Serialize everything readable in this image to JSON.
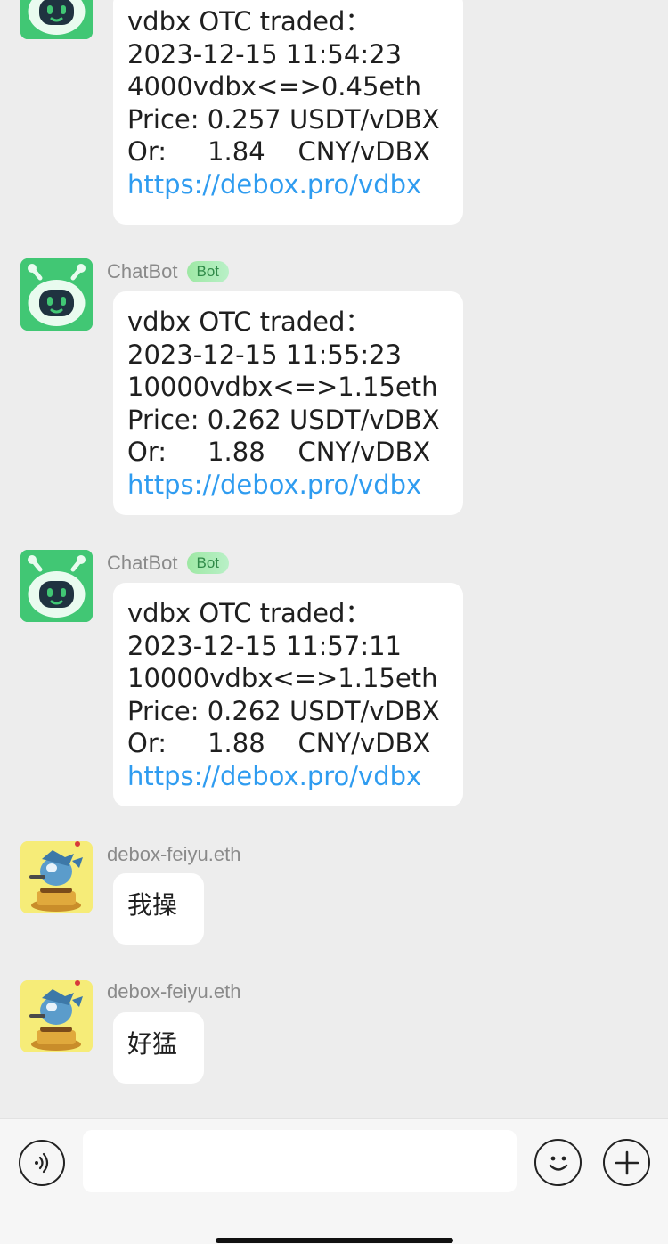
{
  "messages": [
    {
      "sender": "",
      "badge": "",
      "lines": [
        "vdbx OTC traded：",
        "2023-12-15 11:54:23",
        "4000vdbx<=>0.45eth",
        "Price: 0.257 USDT/vDBX",
        "Or:     1.84    CNY/vDBX"
      ],
      "link": "https://debox.pro/vdbx"
    },
    {
      "sender": "ChatBot",
      "badge": "Bot",
      "lines": [
        "vdbx OTC traded：",
        "2023-12-15 11:55:23",
        "10000vdbx<=>1.15eth",
        "Price: 0.262 USDT/vDBX",
        "Or:     1.88    CNY/vDBX"
      ],
      "link": "https://debox.pro/vdbx"
    },
    {
      "sender": "ChatBot",
      "badge": "Bot",
      "lines": [
        "vdbx OTC traded：",
        "2023-12-15 11:57:11",
        "10000vdbx<=>1.15eth",
        "Price: 0.262 USDT/vDBX",
        "Or:     1.88    CNY/vDBX"
      ],
      "link": "https://debox.pro/vdbx"
    },
    {
      "sender": "debox-feiyu.eth",
      "text": "我操"
    },
    {
      "sender": "debox-feiyu.eth",
      "text": "好猛"
    }
  ],
  "input": {
    "voice_icon": "voice-icon",
    "emoji_icon": "emoji-icon",
    "add_icon": "plus-icon",
    "placeholder": ""
  },
  "colors": {
    "bot_avatar": "#41c774",
    "link": "#2f9cf0",
    "background": "#ededed"
  }
}
